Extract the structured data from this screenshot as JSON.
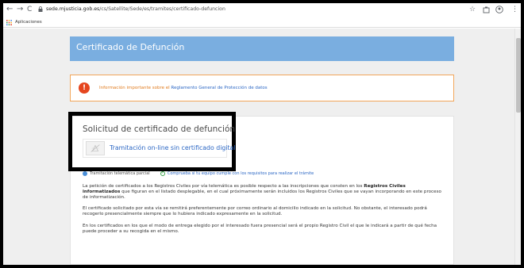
{
  "browser": {
    "url_host": "sede.mjusticia.gob.es",
    "url_path": "/cs/Satellite/Sede/es/tramites/certificado-defuncion",
    "bookmarks_apps_label": "Aplicaciones",
    "icons": {
      "back": "←",
      "forward": "→",
      "reload": "C",
      "star": "☆",
      "menu": "⋮"
    }
  },
  "header": {
    "title": "Certificado de Defunción"
  },
  "notice": {
    "icon": "!",
    "text_before": "Información importante sobre el",
    "link": "Reglamento General de Protección de datos"
  },
  "card": {
    "title": "Solicitud de certificado de defunción",
    "tramitacion_link": "Tramitación on-line sin certificado digital",
    "status_partial": "Tramitación telemática parcial",
    "status_check_link": "Comprueba si tu equipo cumple con los requisitos para realizar el trámite",
    "check_mark": "✓",
    "paragraph1_before": "La petición de certificados a los Registros Civiles por vía telemática es posible respecto a las inscripciones que consten en los",
    "paragraph1_bold": "Registros Civiles informatizados",
    "paragraph1_after": "que figuran en el listado desplegable, en el cual próximamente serán incluidos los Registros Civiles que se vayan incorporando en este proceso de informatización.",
    "paragraph2": "El certificado solicitado por esta vía se remitirá preferentemente por correo ordinario al domicilio indicado en la solicitud. No obstante, el interesado podrá recogerlo presencialmente siempre que lo hubiera indicado expresamente en la solicitud.",
    "paragraph3": "En los certificados en los que el modo de entrega elegido por el interesado fuera presencial será el propio Registro Civil el que le indicará a partir de qué fecha puede proceder a su recogida en el mismo."
  },
  "colors": {
    "header_bg": "#7aaee0",
    "notice_border": "#f2a65a",
    "notice_icon": "#e5461f",
    "link": "#2a66c4",
    "highlight_box": "#000000"
  }
}
